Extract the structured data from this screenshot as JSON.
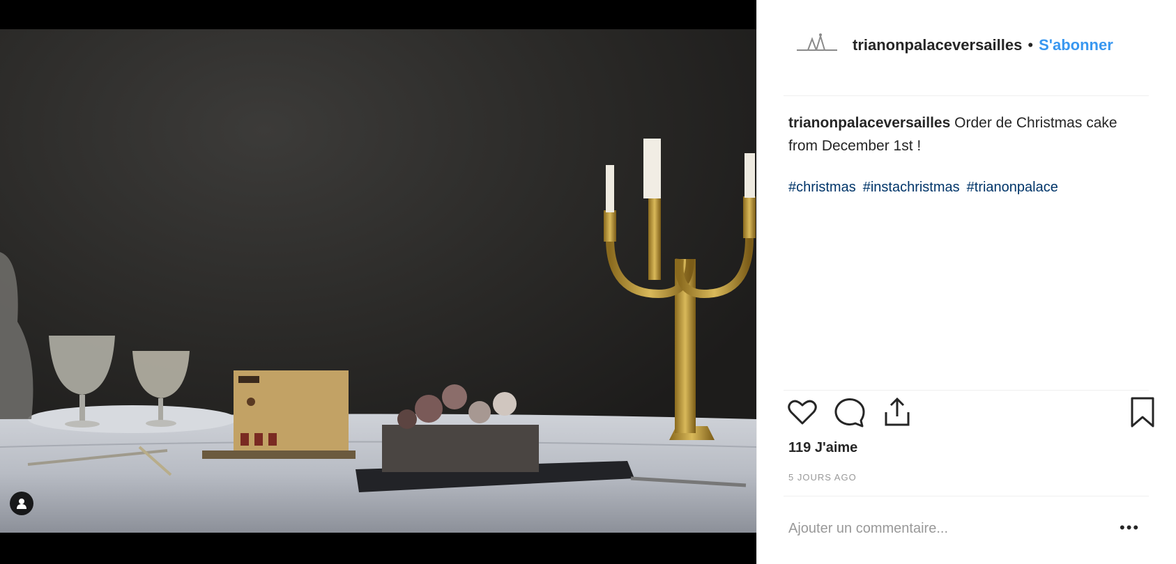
{
  "post": {
    "username": "trianonpalaceversailles",
    "header_separator": "•",
    "follow_label": "S'abonner",
    "caption_text": "Order de Christmas cake from December 1st !",
    "hashtags": [
      "#christmas",
      "#instachristmas",
      "#trianonpalace"
    ],
    "likes": "119 J'aime",
    "date": "5 JOURS AGO",
    "comment_placeholder": "Ajouter un commentaire...",
    "more_label": "•••"
  },
  "icons": {
    "like": "heart-icon",
    "comment": "comment-icon",
    "share": "share-icon",
    "save": "bookmark-icon",
    "user_tag": "user-tag-icon"
  },
  "colors": {
    "follow": "#3897f0",
    "hashtag": "#003569",
    "text": "#262626",
    "muted": "#999999"
  }
}
